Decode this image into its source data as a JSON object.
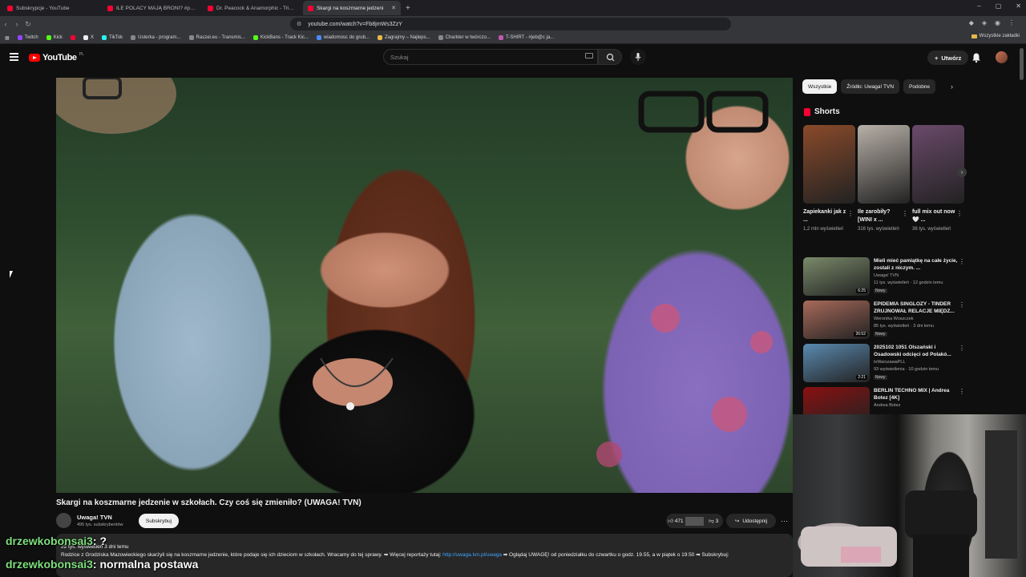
{
  "browser": {
    "tabs": [
      {
        "label": "Subskrypcje - YouTube",
        "active": false
      },
      {
        "label": "ILE POLACY MAJĄ BRONI? #polska #",
        "active": false
      },
      {
        "label": "Dr. Peacock & Anamorphic - Trip to",
        "active": false
      },
      {
        "label": "Skargi na koszmarne jedzeni",
        "active": true
      }
    ],
    "url": "youtube.com/watch?v=Fb8jmWs3ZzY",
    "bookmarks": [
      "Twitch",
      "Kick",
      "X",
      "TikTok",
      "Usterka - program...",
      "Raszei.eu - Transmis...",
      "KickBans - Track Kic...",
      "wiadomosc do grub...",
      "Zagrajmy – Najleps...",
      "Charkter w twórczo...",
      "T-SHIRT - #jeb@c ja..."
    ],
    "all_bookmarks_label": "Wszystkie zakładki"
  },
  "youtube": {
    "logo_text": "YouTube",
    "country_code": "PL",
    "search_placeholder": "Szukaj",
    "create_label": "Utwórz"
  },
  "video": {
    "title": "Skargi na koszmarne jedzenie w szkołach. Czy coś się zmieniło? (UWAGA! TVN)",
    "channel_name": "Uwaga! TVN",
    "subscribers": "495 tys. subskrybentów",
    "subscribe_label": "Subskrybuj",
    "likes": "471",
    "dislikes": "3",
    "share_label": "Udostępnij",
    "description_meta": "22 tys. wyświetleń  3 dni temu",
    "description_text": "Rodzice z Grodziska Mazowieckiego skarżyli się na koszmarne jedzenie, które podaje się ich dzieciom w szkołach. Wracamy do tej sprawy. ➡ Więcej reportaży tutaj: ",
    "description_link": "http://uwaga.tvn.pl/uwaga",
    "description_tail": " ➡ Oglądaj UWAGĘ! od poniedziałku do czwartku o godz. 19.55, a w piątek o 19:50 ➡ Subskrybuj:"
  },
  "overlay_chat": [
    {
      "user": "drzewkobonsai3",
      "message": ": ?"
    },
    {
      "user": "drzewkobonsai3",
      "message": ": normalna postawa"
    }
  ],
  "sidebar": {
    "chips": [
      "Wszystkie",
      "Źródło: Uwaga! TVN",
      "Podobne"
    ],
    "shorts_title": "Shorts",
    "shorts": [
      {
        "title": "Zapiekanki jak z ...",
        "views": "1,2 mln wyświetleń",
        "thumb_color": "#8a4a2a"
      },
      {
        "title": "Ile zarobiły? [WINI x ...",
        "views": "316 tys. wyświetleń",
        "thumb_color": "#b8b0a8"
      },
      {
        "title": "full mix out now 🤍 ...",
        "views": "36 tys. wyświetleń",
        "thumb_color": "#6a4a6a"
      }
    ],
    "recommendations": [
      {
        "title": "Mieli mieć pamiątkę na całe życie, zostali z niczym. ...",
        "channel": "Uwaga! TVN",
        "meta": "11 tys. wyświetleń · 12 godzin temu",
        "badge": "Nowy",
        "duration": "6:25",
        "thumb_color": "#7a8a6a"
      },
      {
        "title": "EPIDEMIA SINGLOZY - TINDER ZRUJNOWAŁ RELACJE MIĘDZ...",
        "channel": "Weronika Woszczek",
        "meta": "85 tys. wyświetleń · 3 dni temu",
        "badge": "Nowy",
        "duration": "26:52",
        "thumb_color": "#a86a5a"
      },
      {
        "title": "2025102 1051 Olszański i Osadowski odcięci od Polakó...",
        "channel": "tvWarszawaPLL",
        "meta": "93 wyświetlenia · 10 godzin temu",
        "badge": "Nowy",
        "duration": "2:21",
        "thumb_color": "#5a8ab0"
      },
      {
        "title": "BERLIN TECHNO MIX | Andrea Botez [4K]",
        "channel": "Andrea Botez",
        "meta": "",
        "badge": "",
        "duration": "",
        "thumb_color": "#8a1010"
      }
    ]
  }
}
